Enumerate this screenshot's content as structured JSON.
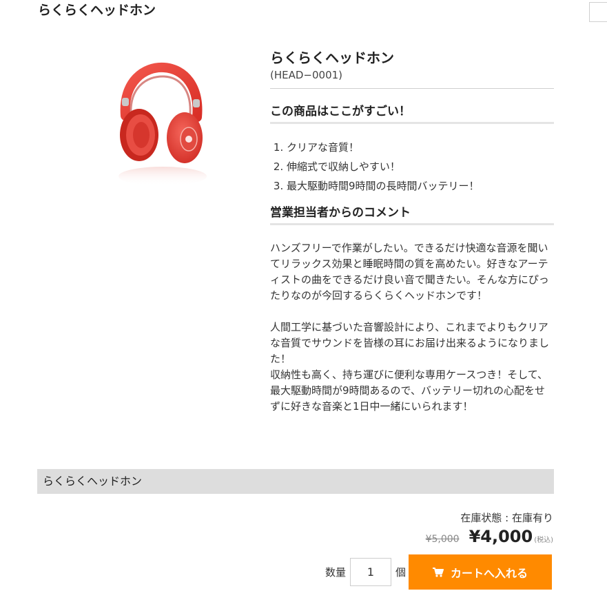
{
  "header": {
    "title": "らくらくヘッドホン"
  },
  "product": {
    "name": "らくらくヘッドホン",
    "code": "(HEAD−0001)",
    "image": {
      "icon": "red-headphones-image",
      "color": "#e63c32"
    },
    "features_heading": "この商品はここがすごい！",
    "features": [
      "クリアな音質！",
      "伸縮式で収納しやすい！",
      "最大駆動時間9時間の長時間バッテリー！"
    ],
    "comment_heading": "営業担当者からのコメント",
    "comment": "ハンズフリーで作業がしたい。できるだけ快適な音源を聞いてリラックス効果と睡眠時間の質を高めたい。好きなアーティストの曲をできるだけ良い音で聞きたい。そんな方にぴったりなのが今回するらくらくヘッドホンです！\n\n人間工学に基づいた音響設計により、これまでよりもクリアな音質でサウンドを皆様の耳にお届け出来るようになりました！\n収納性も高く、持ち運びに便利な専用ケースつき！そして、最大駆動時間が9時間あるので、バッテリー切れの心配をせずに好きな音楽と1日中一緒にいられます！"
  },
  "purchase": {
    "product_name": "らくらくヘッドホン",
    "stock_label": "在庫状態 : 在庫有り",
    "old_price": "¥5,000",
    "price": "¥4,000",
    "tax_note": "(税込)",
    "qty_label": "数量",
    "qty_value": "1",
    "qty_unit": "個",
    "cart_button_label": "カートへ入れる",
    "cart_icon": "shopping-cart-icon",
    "accent_color": "#ff8a00"
  }
}
